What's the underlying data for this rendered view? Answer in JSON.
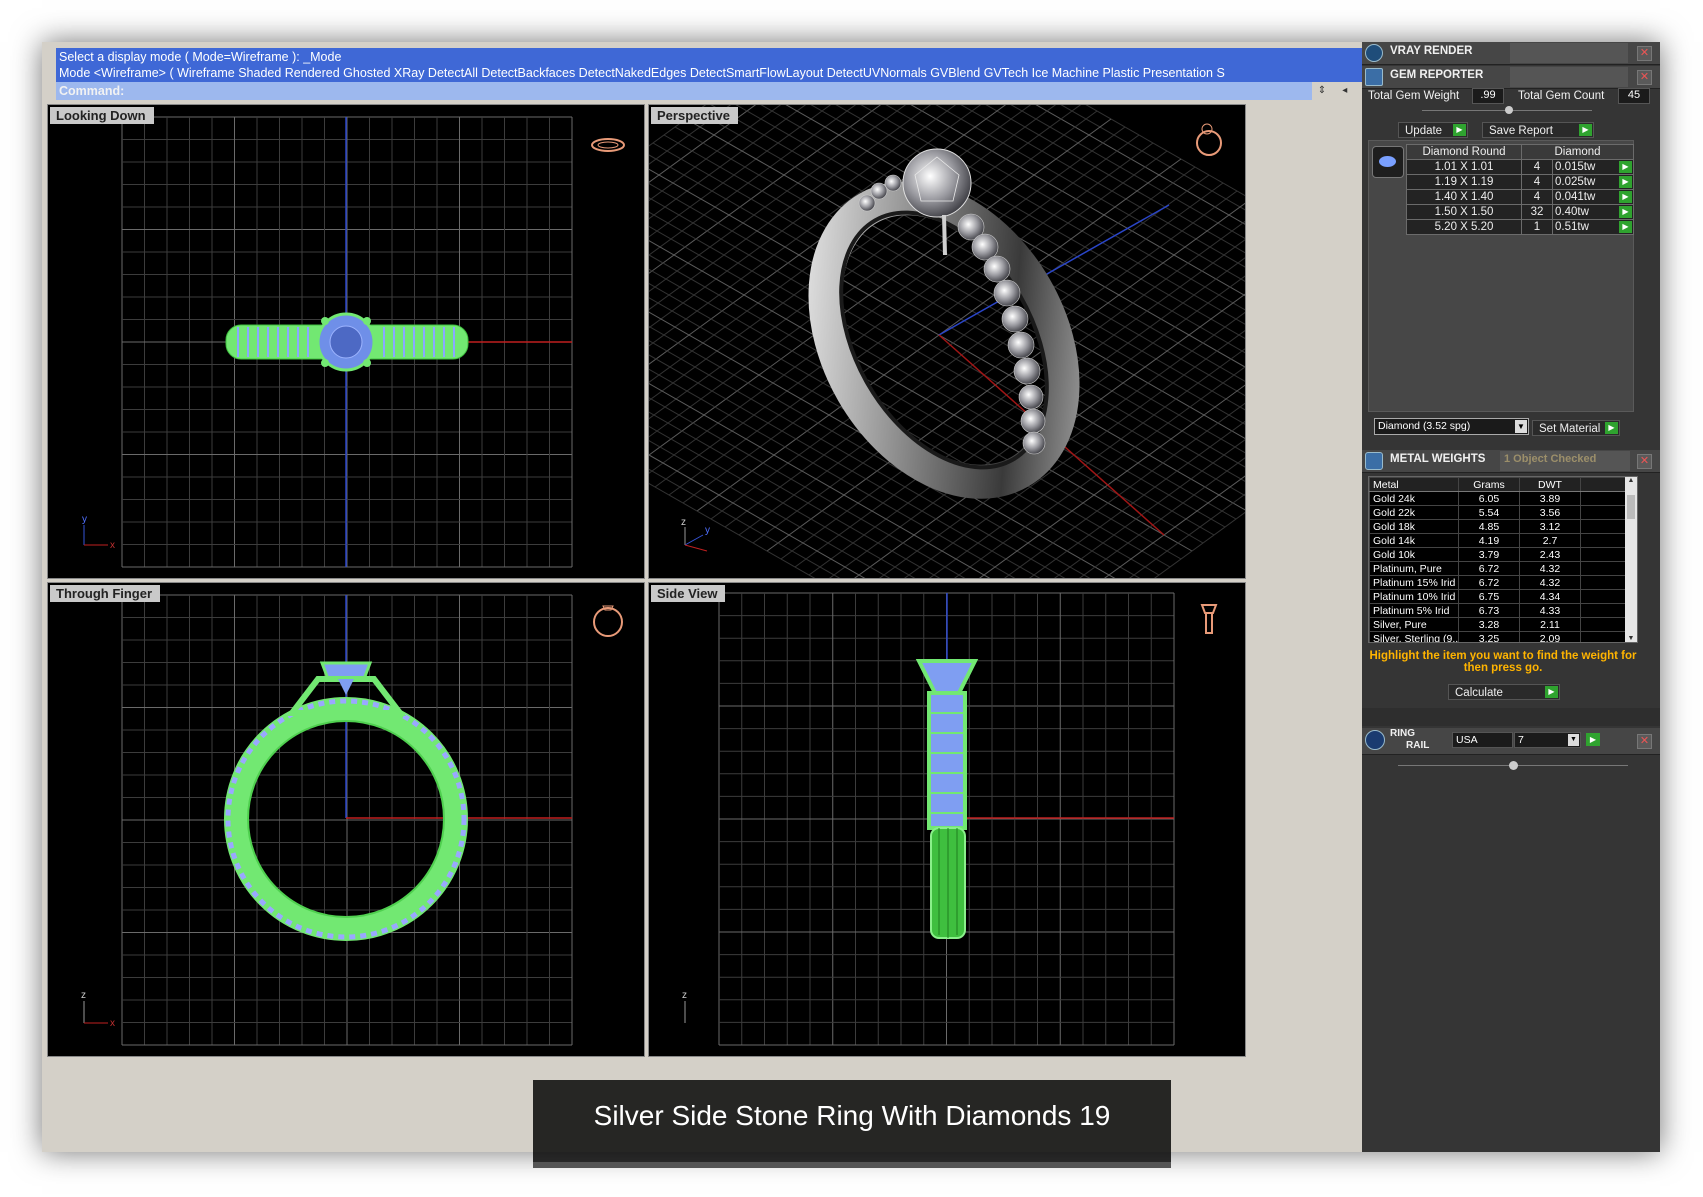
{
  "command": {
    "history_line1": "Select a display mode ( Mode=Wireframe ): _Mode",
    "history_line2": "Mode <Wireframe> ( Wireframe  Shaded  Rendered  Ghosted  XRay  DetectAll  DetectBackfaces  DetectNakedEdges  DetectSmartFlowLayout  DetectUVNormals  GVBlend  GVTech  Ice  Machine  Plastic  Presentation  S",
    "prompt_label": "Command:",
    "prompt_value": ""
  },
  "viewports": {
    "top_left": "Looking Down",
    "top_right": "Perspective",
    "bottom_left": "Through Finger",
    "bottom_right": "Side View"
  },
  "caption": "Silver Side Stone Ring With Diamonds 19",
  "panel": {
    "vray_title": "VRAY RENDER",
    "gem_title": "GEM REPORTER",
    "total_gem_weight_label": "Total Gem Weight",
    "total_gem_weight": ".99",
    "total_gem_count_label": "Total Gem Count",
    "total_gem_count": "45",
    "update_label": "Update",
    "save_report_label": "Save Report",
    "gem_table": {
      "headers": [
        "Diamond Round",
        "Diamond"
      ],
      "rows": [
        [
          "1.01 X 1.01",
          "4",
          "0.015tw"
        ],
        [
          "1.19 X 1.19",
          "4",
          "0.025tw"
        ],
        [
          "1.40 X 1.40",
          "4",
          "0.041tw"
        ],
        [
          "1.50 X 1.50",
          "32",
          "0.40tw"
        ],
        [
          "5.20 X 5.20",
          "1",
          "0.51tw"
        ]
      ]
    },
    "material_select": "Diamond    (3.52 spg)",
    "set_material_label": "Set Material",
    "metal_title": "METAL WEIGHTS",
    "metal_status": "1 Object Checked",
    "metal_table": {
      "headers": [
        "Metal",
        "Grams",
        "DWT"
      ],
      "rows": [
        [
          "Gold 24k",
          "6.05",
          "3.89"
        ],
        [
          "Gold 22k",
          "5.54",
          "3.56"
        ],
        [
          "Gold 18k",
          "4.85",
          "3.12"
        ],
        [
          "Gold 14k",
          "4.19",
          "2.7"
        ],
        [
          "Gold 10k",
          "3.79",
          "2.43"
        ],
        [
          "Platinum, Pure",
          "6.72",
          "4.32"
        ],
        [
          "Platinum 15% Irid",
          "6.72",
          "4.32"
        ],
        [
          "Platinum 10% Irid",
          "6.75",
          "4.34"
        ],
        [
          "Platinum 5% Irid",
          "6.73",
          "4.33"
        ],
        [
          "Silver, Pure",
          "3.28",
          "2.11"
        ],
        [
          "Silver, Sterling (9...",
          "3.25",
          "2.09"
        ]
      ]
    },
    "highlight_hint": "Highlight the item you want to find the weight for then press go.",
    "calculate_label": "Calculate",
    "ring_rail_label_1": "RING",
    "ring_rail_label_2": "RAIL",
    "ring_size_system": "USA",
    "ring_size": "7"
  }
}
